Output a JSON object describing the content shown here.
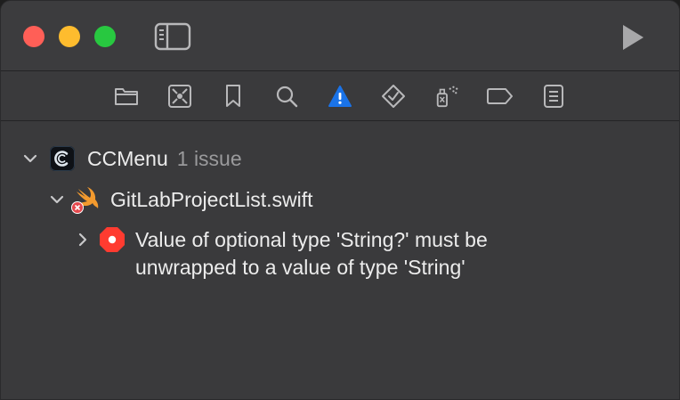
{
  "window": {
    "controls": [
      "close",
      "minimize",
      "zoom"
    ]
  },
  "toolbar": {
    "icons": [
      "folder-icon",
      "source-control-icon",
      "bookmark-icon",
      "search-icon",
      "warning-icon",
      "test-icon",
      "debug-icon",
      "breakpoint-icon",
      "report-icon"
    ]
  },
  "issues": {
    "project": {
      "name": "CCMenu",
      "count_label": "1 issue"
    },
    "file": {
      "name": "GitLabProjectList.swift"
    },
    "error": {
      "line1": "Value of optional type 'String?' must be",
      "line2": "unwrapped to a value of type 'String'"
    }
  },
  "colors": {
    "accent": "#1a73e8",
    "error": "#ff3b30",
    "background": "#3a3a3c"
  }
}
